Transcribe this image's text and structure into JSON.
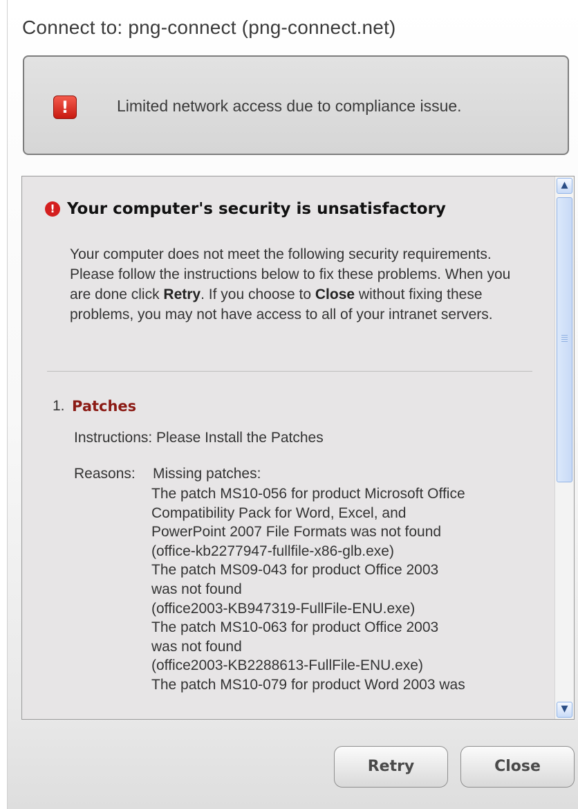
{
  "title": "Connect to: png-connect (png-connect.net)",
  "status": {
    "icon": "exclamation-icon",
    "icon_text": "!",
    "message": "Limited network access due to compliance issue."
  },
  "report": {
    "heading_icon_text": "!",
    "heading": "Your computer's security is unsatisfactory",
    "intro": {
      "part1": "Your computer does not meet the following security requirements. Please follow the instructions below to fix these problems. When you are done click ",
      "retry_word": "Retry",
      "part2": ". If you choose to ",
      "close_word": "Close",
      "part3": " without fixing these problems, you may not have access to all of your intranet servers."
    },
    "item_number": "1.",
    "item_title": "Patches",
    "instructions": "Instructions: Please Install the Patches",
    "reasons_label": "Reasons:",
    "reasons_first": "Missing patches:",
    "reasons_lines": [
      "The patch MS10-056 for product Microsoft Office",
      "Compatibility Pack for Word, Excel, and",
      "PowerPoint 2007 File Formats was not found",
      "(office-kb2277947-fullfile-x86-glb.exe)",
      "The patch MS09-043 for product Office 2003",
      "was not found",
      "(office2003-KB947319-FullFile-ENU.exe)",
      "The patch MS10-063 for product Office 2003",
      "was not found",
      "(office2003-KB2288613-FullFile-ENU.exe)",
      "The patch MS10-079 for product Word 2003 was"
    ]
  },
  "scrollbar": {
    "up_glyph": "▲",
    "down_glyph": "▼"
  },
  "buttons": {
    "retry": "Retry",
    "close": "Close"
  }
}
